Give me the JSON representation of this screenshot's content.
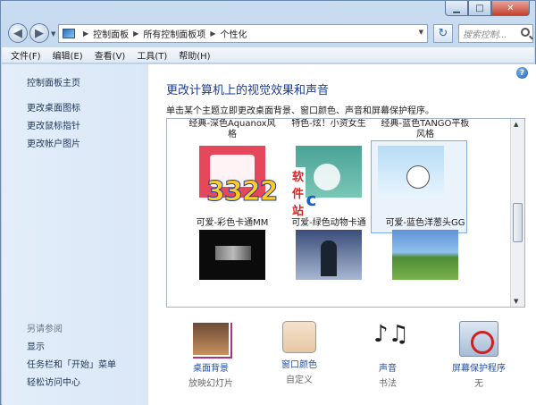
{
  "window": {
    "caption_buttons": [
      "minimize-icon",
      "maximize-icon",
      "close-icon"
    ]
  },
  "nav": {
    "breadcrumb": [
      "控制面板",
      "所有控制面板项",
      "个性化"
    ],
    "search_placeholder": "搜索控制..."
  },
  "menu": [
    "文件(F)",
    "编辑(E)",
    "查看(V)",
    "工具(T)",
    "帮助(H)"
  ],
  "left": {
    "home": "控制面板主页",
    "links": [
      "更改桌面图标",
      "更改鼠标指针",
      "更改帐户图片"
    ],
    "see_also_title": "另请参阅",
    "see_also": [
      "显示",
      "任务栏和「开始」菜单",
      "轻松访问中心"
    ]
  },
  "main": {
    "title": "更改计算机上的视觉效果和声音",
    "subtitle": "单击某个主题立即更改桌面背景、窗口颜色、声音和屏幕保护程序。",
    "themes_row1": [
      {
        "label": "经典-深色Aquanox风格"
      },
      {
        "label": "特色-炫！小资女生"
      },
      {
        "label": "经典-蓝色TANGO平板风格"
      }
    ],
    "themes_row2": [
      {
        "label": "可爱-彩色卡通MM"
      },
      {
        "label": "可爱-绿色动物卡通"
      },
      {
        "label": "可爱-蓝色洋葱头GG"
      }
    ]
  },
  "watermark": {
    "number": "3322",
    "domain": ".cc",
    "cn": "软件站"
  },
  "actions": [
    {
      "title": "桌面背景",
      "sub": "放映幻灯片"
    },
    {
      "title": "窗口颜色",
      "sub": "自定义"
    },
    {
      "title": "声音",
      "sub": "书法"
    },
    {
      "title": "屏幕保护程序",
      "sub": "无"
    }
  ]
}
